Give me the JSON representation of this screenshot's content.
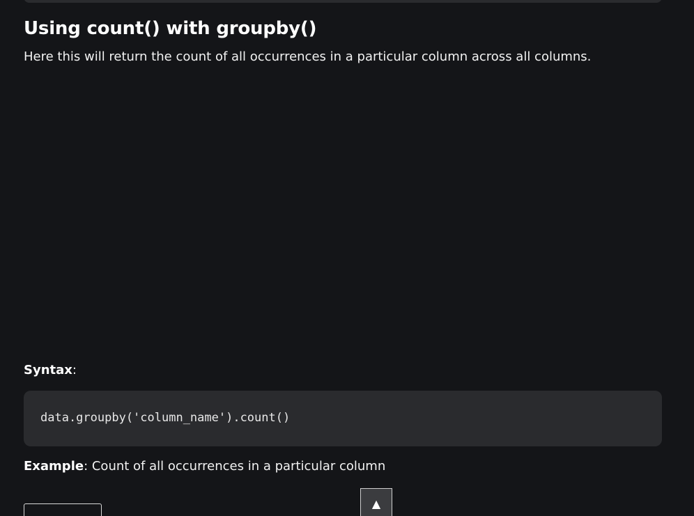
{
  "article": {
    "heading": "Using count() with groupby()",
    "intro": "Here this will return the count of all occurrences in a particular column across all columns.",
    "syntax": {
      "label": "Syntax",
      "suffix": ":",
      "code": "data.groupby('column_name').count()"
    },
    "example": {
      "label": "Example",
      "suffix": ": Count of all occurrences in a particular column"
    }
  },
  "controls": {
    "scroll_top_glyph": "▲",
    "scroll_top_icon": "arrow-up-icon"
  },
  "colors": {
    "background": "#141518",
    "code_background": "#2a2b2e",
    "text": "#ffffff"
  }
}
